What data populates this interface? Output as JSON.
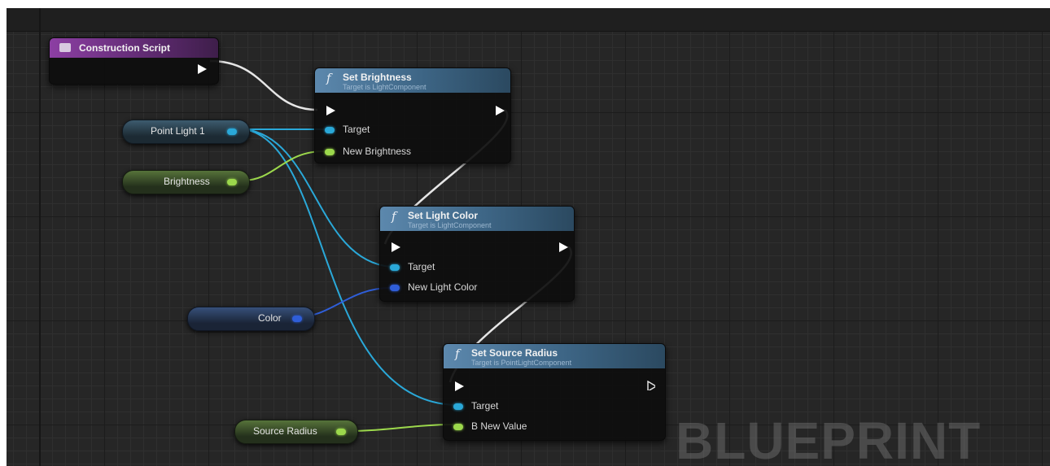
{
  "construction_script": {
    "title": "Construction Script"
  },
  "nodes": {
    "set_brightness": {
      "fx": "f",
      "title": "Set Brightness",
      "subtitle": "Target is LightComponent",
      "pins": {
        "target": "Target",
        "value": "New Brightness"
      }
    },
    "set_light_color": {
      "fx": "f",
      "title": "Set Light Color",
      "subtitle": "Target is LightComponent",
      "pins": {
        "target": "Target",
        "value": "New Light Color"
      }
    },
    "set_source_radius": {
      "fx": "f",
      "title": "Set Source Radius",
      "subtitle": "Target is PointLightComponent",
      "pins": {
        "target": "Target",
        "value": "B New Value"
      }
    }
  },
  "variables": {
    "point_light": "Point Light 1",
    "brightness": "Brightness",
    "color": "Color",
    "source_radius": "Source Radius"
  },
  "watermark": "BLUEPRINT",
  "colors": {
    "exec_wire": "#e8e8e8",
    "object_pin": "#2aa8d8",
    "float_pin": "#9cd84c",
    "color_pin": "#2f5ed8",
    "node_header": "#4a7396",
    "event_header": "#7a3a90"
  }
}
